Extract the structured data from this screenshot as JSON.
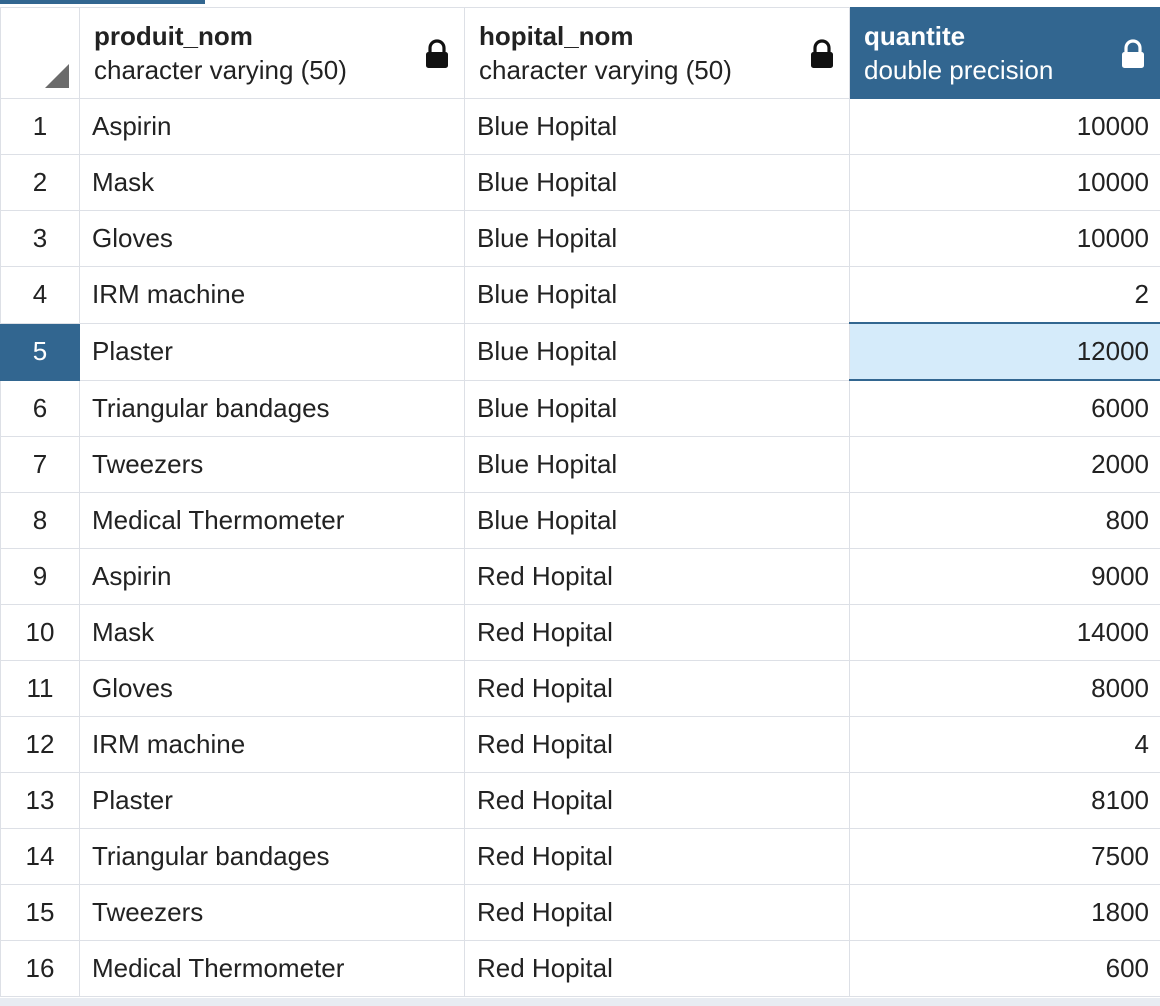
{
  "columns": [
    {
      "name": "produit_nom",
      "type": "character varying (50)"
    },
    {
      "name": "hopital_nom",
      "type": "character varying (50)"
    },
    {
      "name": "quantite",
      "type": "double precision"
    }
  ],
  "selected_column": "quantite",
  "selected_row": 5,
  "rows": [
    {
      "num": "1",
      "produit_nom": "Aspirin",
      "hopital_nom": "Blue Hopital",
      "quantite": "10000"
    },
    {
      "num": "2",
      "produit_nom": "Mask",
      "hopital_nom": "Blue Hopital",
      "quantite": "10000"
    },
    {
      "num": "3",
      "produit_nom": "Gloves",
      "hopital_nom": "Blue Hopital",
      "quantite": "10000"
    },
    {
      "num": "4",
      "produit_nom": "IRM machine",
      "hopital_nom": "Blue Hopital",
      "quantite": "2"
    },
    {
      "num": "5",
      "produit_nom": "Plaster",
      "hopital_nom": "Blue Hopital",
      "quantite": "12000"
    },
    {
      "num": "6",
      "produit_nom": "Triangular bandages",
      "hopital_nom": "Blue Hopital",
      "quantite": "6000"
    },
    {
      "num": "7",
      "produit_nom": "Tweezers",
      "hopital_nom": "Blue Hopital",
      "quantite": "2000"
    },
    {
      "num": "8",
      "produit_nom": "Medical Thermometer",
      "hopital_nom": "Blue Hopital",
      "quantite": "800"
    },
    {
      "num": "9",
      "produit_nom": "Aspirin",
      "hopital_nom": "Red Hopital",
      "quantite": "9000"
    },
    {
      "num": "10",
      "produit_nom": "Mask",
      "hopital_nom": "Red Hopital",
      "quantite": "14000"
    },
    {
      "num": "11",
      "produit_nom": "Gloves",
      "hopital_nom": "Red Hopital",
      "quantite": "8000"
    },
    {
      "num": "12",
      "produit_nom": "IRM machine",
      "hopital_nom": "Red Hopital",
      "quantite": "4"
    },
    {
      "num": "13",
      "produit_nom": "Plaster",
      "hopital_nom": "Red Hopital",
      "quantite": "8100"
    },
    {
      "num": "14",
      "produit_nom": "Triangular bandages",
      "hopital_nom": "Red Hopital",
      "quantite": "7500"
    },
    {
      "num": "15",
      "produit_nom": "Tweezers",
      "hopital_nom": "Red Hopital",
      "quantite": "1800"
    },
    {
      "num": "16",
      "produit_nom": "Medical Thermometer",
      "hopital_nom": "Red Hopital",
      "quantite": "600"
    }
  ],
  "colors": {
    "accent": "#326690",
    "selected_cell": "#d5ebfa",
    "grid_line": "#dde0e6"
  },
  "icons": {
    "column_lock": "lock-icon",
    "select_all": "select-all-corner-icon"
  }
}
